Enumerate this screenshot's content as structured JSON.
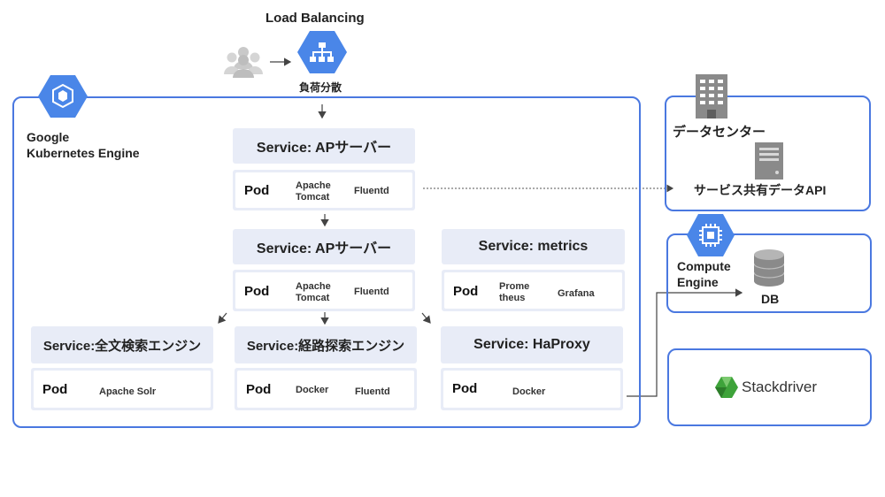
{
  "load_balancing": {
    "title": "Load Balancing",
    "subtitle": "負荷分散"
  },
  "gke": {
    "label_line1": "Google",
    "label_line2": "Kubernetes Engine"
  },
  "services": {
    "ap1": {
      "title": "Service: APサーバー",
      "pod": "Pod",
      "item1_line1": "Apache",
      "item1_line2": "Tomcat",
      "item2": "Fluentd"
    },
    "ap2": {
      "title": "Service: APサーバー",
      "pod": "Pod",
      "item1_line1": "Apache",
      "item1_line2": "Tomcat",
      "item2": "Fluentd"
    },
    "metrics": {
      "title": "Service: metrics",
      "pod": "Pod",
      "item1_line1": "Prome",
      "item1_line2": "theus",
      "item2": "Grafana"
    },
    "fulltext": {
      "title": "Service:全文検索エンジン",
      "pod": "Pod",
      "item1": "Apache Solr"
    },
    "route": {
      "title": "Service:経路探索エンジン",
      "pod": "Pod",
      "item1": "Docker",
      "item2": "Fluentd"
    },
    "haproxy": {
      "title": "Service: HaProxy",
      "pod": "Pod",
      "item1": "Docker"
    }
  },
  "datacenter": {
    "title": "データセンター",
    "api": "サービス共有データAPI"
  },
  "compute": {
    "label_line1": "Compute",
    "label_line2": "Engine",
    "db": "DB"
  },
  "stackdriver": {
    "label": "Stackdriver"
  },
  "colors": {
    "frame_blue": "#4a78e0",
    "hex_blue": "#4a86e8",
    "panel_bg": "#e8ecf7",
    "stackdriver_green": "#3ea33a"
  }
}
